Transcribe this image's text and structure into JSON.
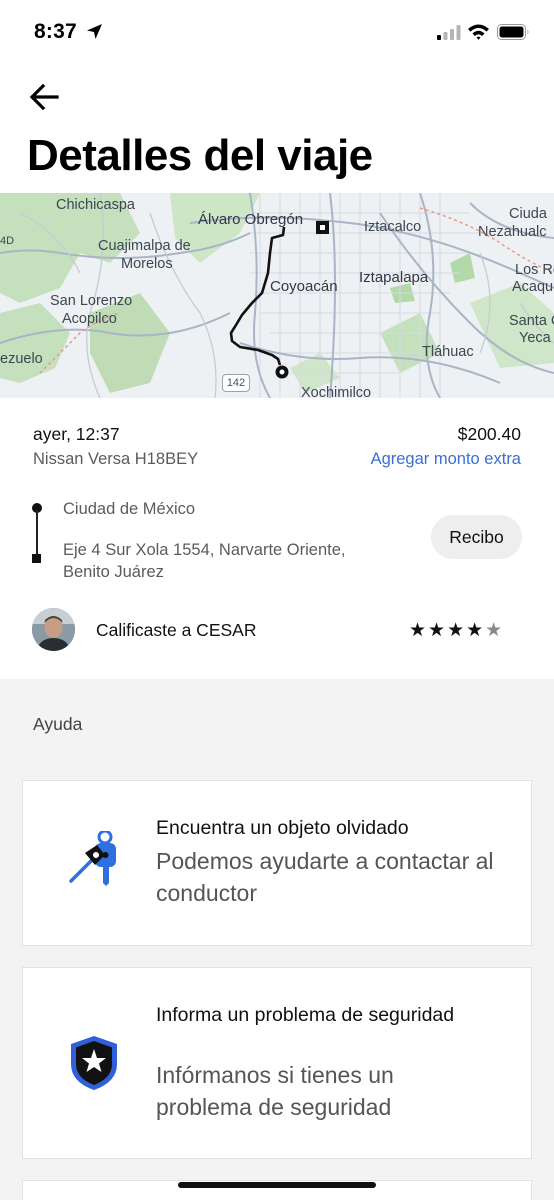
{
  "status_bar": {
    "time": "8:37",
    "icons": [
      "location-arrow-icon",
      "cellular-signal-icon",
      "wifi-icon",
      "battery-icon"
    ]
  },
  "header": {
    "back_icon": "arrow-left-icon",
    "title": "Detalles del viaje"
  },
  "map": {
    "labels": [
      "Chichicaspa",
      "Álvaro Obregón",
      "Iztacalco",
      "Ciuda",
      "Nezahualc",
      "Cuajimalpa de",
      "Morelos",
      "Los Re",
      "Acaqu",
      "Iztapalapa",
      "Coyoacán",
      "San Lorenzo",
      "Acopilco",
      "Santa C",
      "Yeca",
      "Tláhuac",
      "ezuelo",
      "Xochimilco",
      "4D"
    ],
    "highway": "142",
    "colors": {
      "route": "#111111",
      "park": "#b8dcb0",
      "road": "#c9cfd8"
    }
  },
  "trip": {
    "datetime": "ayer, 12:37",
    "fare": "$200.40",
    "vehicle": "Nissan Versa H18BEY",
    "add_extra_label": "Agregar monto extra",
    "pickup": "Ciudad de México",
    "dropoff": "Eje 4 Sur Xola 1554, Narvarte Oriente, Benito Juárez",
    "receipt_label": "Recibo"
  },
  "rating": {
    "text": "Calificaste a CESAR",
    "stars": 4.5,
    "stars_max": 5,
    "stars_glyphs": "★★★★",
    "half_glyph": "★"
  },
  "help": {
    "section_label": "Ayuda",
    "cards": [
      {
        "icon": "keys-icon",
        "title": "Encuentra un objeto olvidado",
        "subtitle": "Podemos ayudarte a contactar al conductor"
      },
      {
        "icon": "shield-star-icon",
        "title": "Informa un problema de seguridad",
        "subtitle": "Infórmanos si tienes un problema de seguridad"
      }
    ]
  },
  "colors": {
    "accent_link": "#3a6fd8",
    "shield_blue": "#2f5fd9",
    "gray_background": "#f3f3f3"
  }
}
